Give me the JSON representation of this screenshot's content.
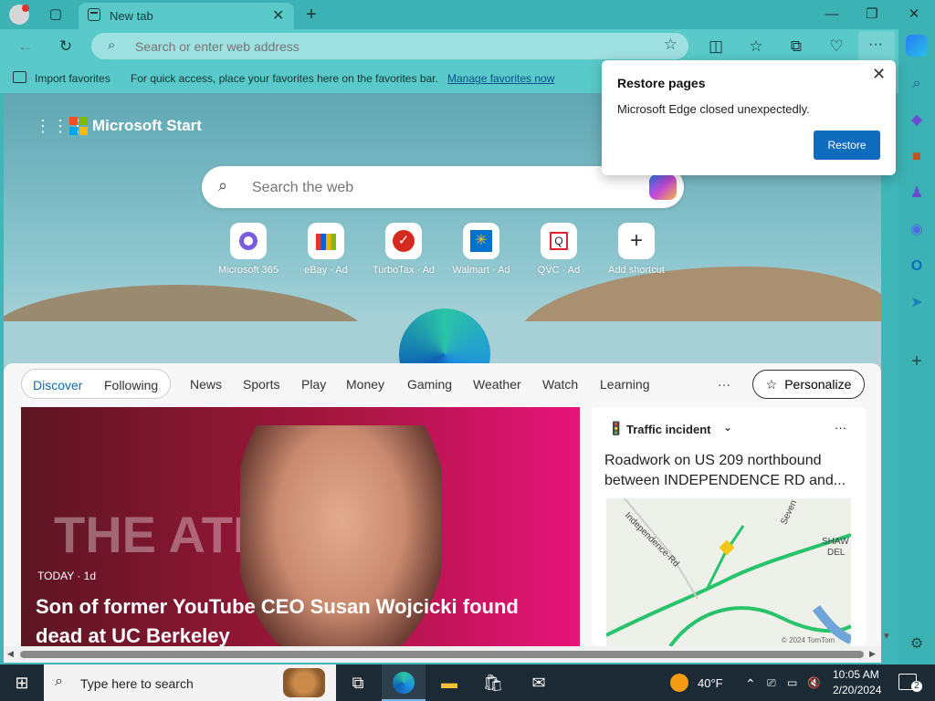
{
  "browser": {
    "tab_title": "New tab",
    "address_placeholder": "Search or enter web address"
  },
  "favorites": {
    "import_label": "Import favorites",
    "hint": "For quick access, place your favorites here on the favorites bar.",
    "manage_link": "Manage favorites now"
  },
  "newtab": {
    "brand": "Microsoft Start",
    "search_placeholder": "Search the web",
    "tiles": [
      {
        "label": "Microsoft 365"
      },
      {
        "label": "eBay · Ad"
      },
      {
        "label": "TurboTax · Ad"
      },
      {
        "label": "Walmart · Ad"
      },
      {
        "label": "QVC · Ad"
      },
      {
        "label": "Add shortcut"
      }
    ]
  },
  "feed": {
    "tabs": {
      "discover": "Discover",
      "following": "Following"
    },
    "nav": [
      "News",
      "Sports",
      "Play",
      "Money",
      "Gaming",
      "Weather",
      "Watch",
      "Learning"
    ],
    "more": "···",
    "personalize": "Personalize",
    "hero": {
      "source": "TODAY · 1d",
      "headline": "Son of former YouTube CEO Susan Wojcicki found dead at UC Berkeley",
      "bg_text": "THE ATLANTIC"
    },
    "traffic": {
      "title": "Traffic incident",
      "text": "Roadwork on US 209 northbound between INDEPENDENCE RD and...",
      "map_labels": [
        "Independence-Rd",
        "Seven",
        "SHAW",
        "DEL",
        "© 2024 TomTom"
      ]
    }
  },
  "popup": {
    "title": "Restore pages",
    "message": "Microsoft Edge closed unexpectedly.",
    "button": "Restore"
  },
  "taskbar": {
    "search_placeholder": "Type here to search",
    "weather": "40°F",
    "time": "10:05 AM",
    "date": "2/20/2024",
    "notifications": "2"
  }
}
